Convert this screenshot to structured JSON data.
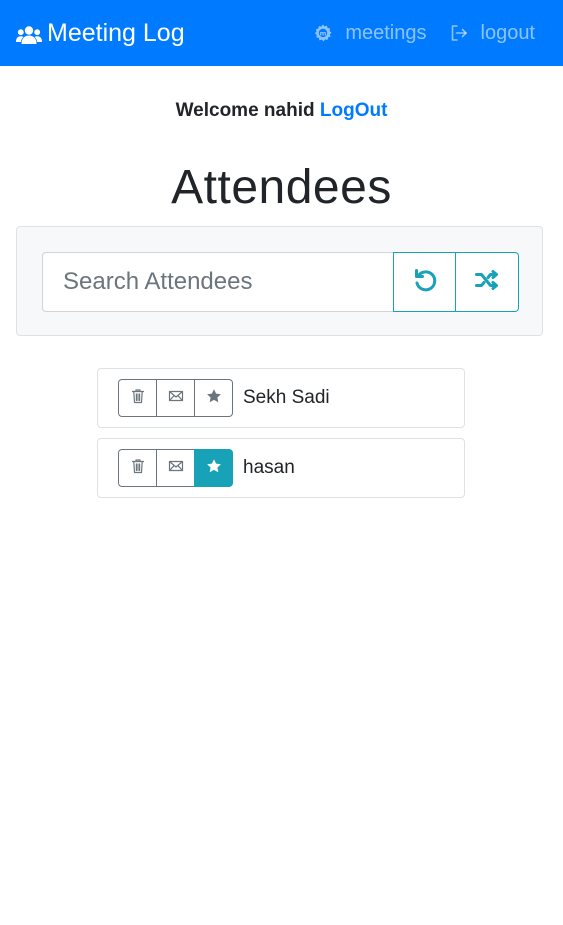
{
  "navbar": {
    "brand": "Meeting Log",
    "brand_icon": "users-icon",
    "links": [
      {
        "label": "meetings",
        "icon": "meetings-icon"
      },
      {
        "label": "logout",
        "icon": "sign-out-icon"
      }
    ],
    "background": "#007bff"
  },
  "welcome": {
    "text": "Welcome nahid",
    "logout_label": "LogOut"
  },
  "page": {
    "title": "Attendees"
  },
  "search": {
    "placeholder": "Search Attendees",
    "value": "",
    "reset_icon": "undo-icon",
    "random_icon": "random-icon"
  },
  "attendees": [
    {
      "name": "Sekh Sadi",
      "starred": false
    },
    {
      "name": "hasan",
      "starred": true
    }
  ],
  "colors": {
    "accent": "#17a2b8",
    "primary": "#007bff",
    "secondary": "#6c757d"
  }
}
